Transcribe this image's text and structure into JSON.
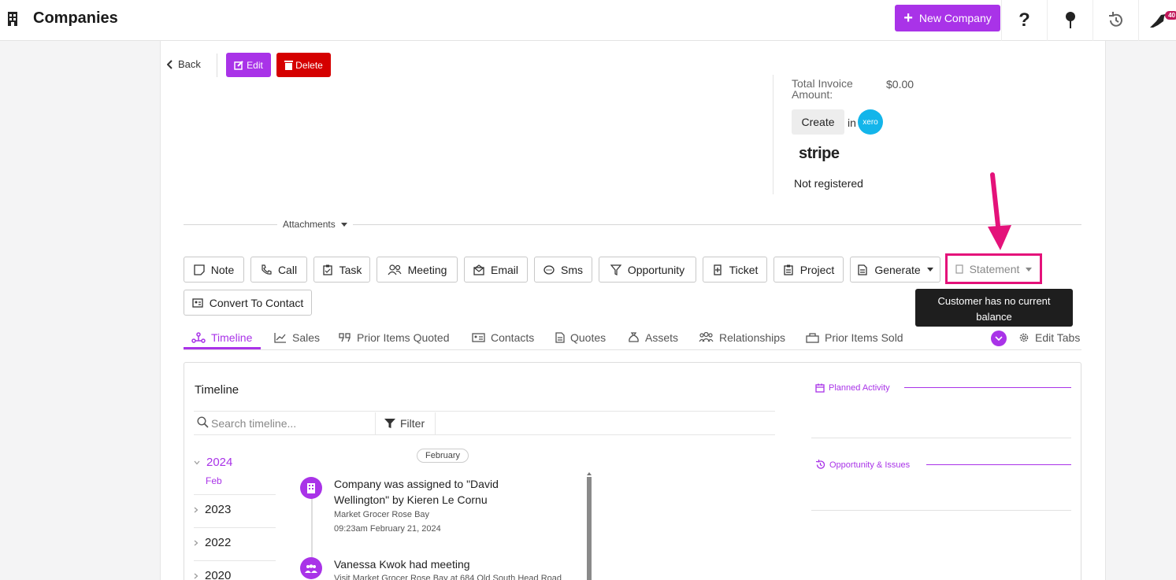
{
  "header": {
    "title": "Companies",
    "new_company_label": "New Company",
    "notification_count": "40"
  },
  "record_toolbar": {
    "back_label": "Back",
    "edit_label": "Edit",
    "delete_label": "Delete"
  },
  "invoice": {
    "total_label": "Total Invoice Amount:",
    "total_value": "$0.00",
    "create_label": "Create",
    "in_label": "in",
    "xero_label": "xero",
    "stripe_label": "stripe",
    "stripe_status": "Not registered"
  },
  "attachments_label": "Attachments",
  "actions": [
    {
      "label": "Note",
      "icon": "note-icon"
    },
    {
      "label": "Call",
      "icon": "phone-icon"
    },
    {
      "label": "Task",
      "icon": "clipboard-icon"
    },
    {
      "label": "Meeting",
      "icon": "users-icon"
    },
    {
      "label": "Email",
      "icon": "envelope-icon"
    },
    {
      "label": "Sms",
      "icon": "chat-icon"
    },
    {
      "label": "Opportunity",
      "icon": "funnel-icon"
    },
    {
      "label": "Ticket",
      "icon": "ticket-icon"
    },
    {
      "label": "Project",
      "icon": "clipboard-icon"
    },
    {
      "label": "Generate",
      "icon": "document-icon"
    },
    {
      "label": "Convert To Contact",
      "icon": "contact-card-icon"
    }
  ],
  "statement": {
    "label": "Statement",
    "tooltip": "Customer has no current balance"
  },
  "tabs": [
    {
      "label": "Timeline",
      "icon": "timeline-icon"
    },
    {
      "label": "Sales",
      "icon": "chart-line-icon"
    },
    {
      "label": "Prior Items Quoted",
      "icon": "quote-icon"
    },
    {
      "label": "Contacts",
      "icon": "contact-card-icon"
    },
    {
      "label": "Quotes",
      "icon": "document-icon"
    },
    {
      "label": "Assets",
      "icon": "money-bag-icon"
    },
    {
      "label": "Relationships",
      "icon": "users-icon"
    },
    {
      "label": "Prior Items Sold",
      "icon": "shopping-bag-icon"
    }
  ],
  "edit_tabs_label": "Edit Tabs",
  "timeline": {
    "title": "Timeline",
    "search_placeholder": "Search timeline...",
    "filter_label": "Filter",
    "years": [
      {
        "label": "2024",
        "months": [
          "Feb"
        ]
      },
      {
        "label": "2023"
      },
      {
        "label": "2022"
      },
      {
        "label": "2020"
      }
    ],
    "month_pill": "February",
    "events": [
      {
        "title": "Company was assigned to \"David Wellington\" by Kieren Le Cornu",
        "company": "Market Grocer Rose Bay",
        "time": "09:23am February 21, 2024"
      },
      {
        "title": "Vanessa Kwok had meeting",
        "company": "Visit Market Grocer Rose Bay at 684 Old South Head Road"
      }
    ]
  },
  "sidebar": {
    "planned_activity": "Planned Activity",
    "opportunity_issues": "Opportunity & Issues"
  },
  "colors": {
    "accent": "#a933e8",
    "danger": "#d50000",
    "highlight": "#e4127a",
    "xero": "#13b5ea"
  }
}
